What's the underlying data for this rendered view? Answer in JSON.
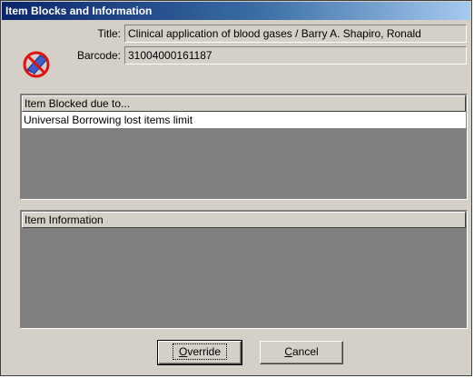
{
  "window": {
    "title": "Item Blocks and Information"
  },
  "fields": {
    "title_label": "Title:",
    "title_value": "Clinical application of blood gases / Barry A. Shapiro, Ronald",
    "barcode_label": "Barcode:",
    "barcode_value": "31004000161187"
  },
  "blocked_panel": {
    "header": "Item Blocked due to...",
    "rows": [
      "Universal Borrowing lost items limit"
    ]
  },
  "info_panel": {
    "header": "Item Information"
  },
  "buttons": {
    "override_mnemonic": "O",
    "override_rest": "verride",
    "cancel_mnemonic": "C",
    "cancel_rest": "ancel"
  },
  "icons": {
    "app_icon": "blocked-book-icon"
  },
  "colors": {
    "titlebar_start": "#0a246a",
    "titlebar_end": "#a6caf0",
    "face": "#d4d0c8",
    "panel_bg": "#808080"
  }
}
